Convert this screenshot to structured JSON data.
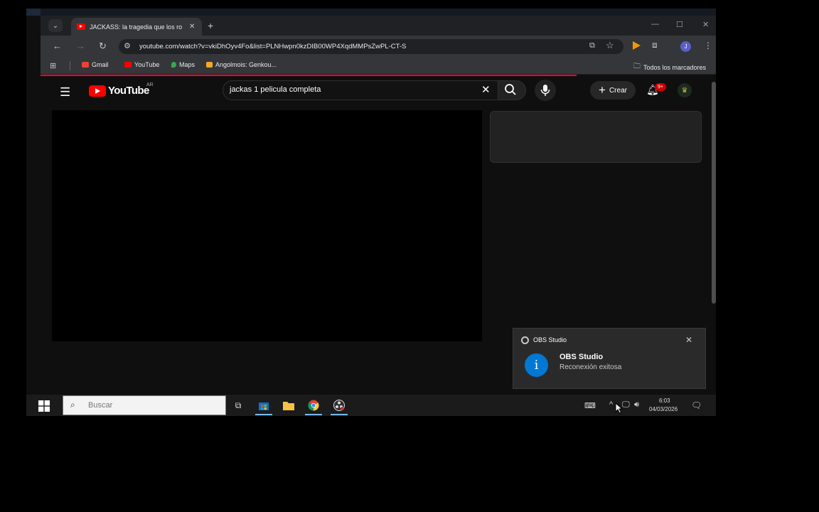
{
  "browser": {
    "tab_title": "JACKASS: la tragedia que los ro",
    "url": "youtube.com/watch?v=vkiDhOyv4Fo&list=PLNHwpn0kzDIB00WP4XqdMMPsZwPL-CT-S",
    "profile_initial": "J",
    "bookmarks": [
      {
        "label": "Gmail",
        "color": "#ea4335"
      },
      {
        "label": "YouTube",
        "color": "#ff0000"
      },
      {
        "label": "Maps",
        "color": "#34a853"
      },
      {
        "label": "Angolmois: Genkou...",
        "color": "#f9a825"
      }
    ],
    "all_bookmarks_label": "Todos los marcadores"
  },
  "youtube": {
    "logo_text": "YouTube",
    "region": "AR",
    "search_value": "jackas 1 pelicula completa",
    "create_label": "Crear",
    "notification_count": "9+"
  },
  "toast": {
    "app_name": "OBS Studio",
    "title": "OBS Studio",
    "message": "Reconexión exitosa"
  },
  "taskbar": {
    "search_placeholder": "Buscar",
    "time": "6:03",
    "date": "04/03/2026"
  },
  "colors": {
    "accent_red": "#ff0000",
    "toast_info_blue": "#0078d4",
    "page_background": "#0f0f0f"
  }
}
